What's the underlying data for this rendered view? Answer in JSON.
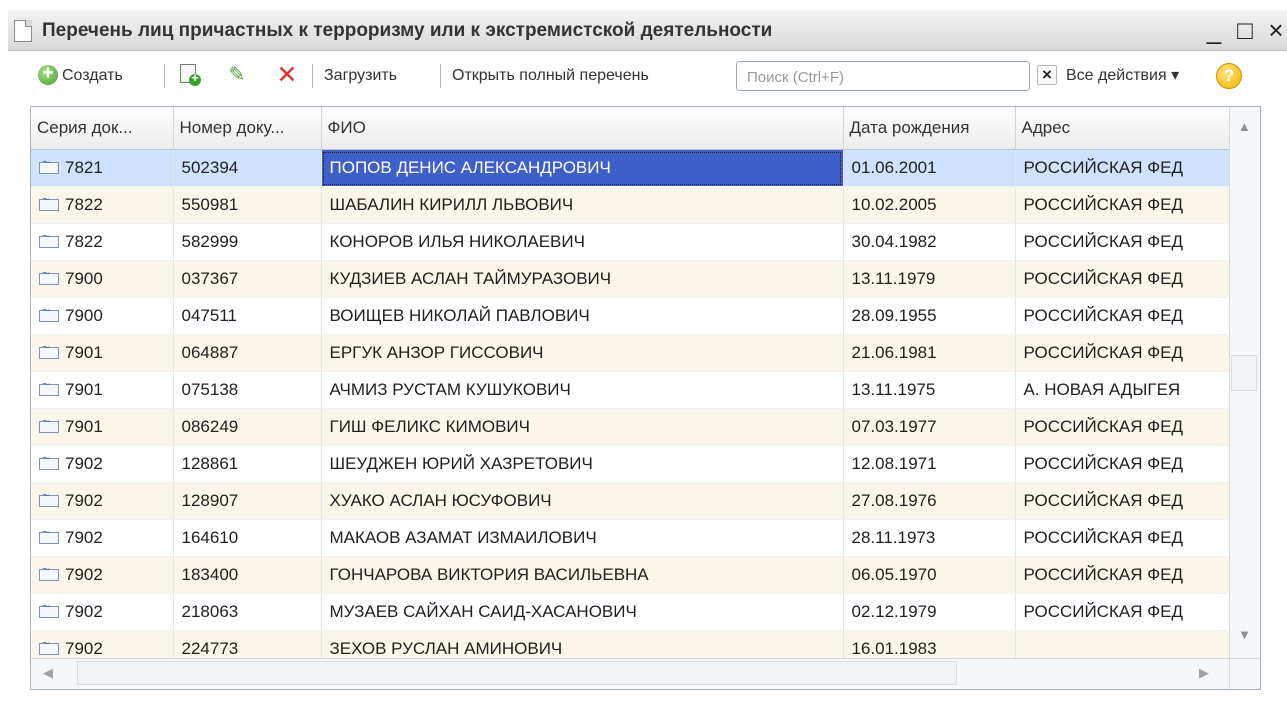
{
  "window": {
    "title": "Перечень лиц причастных к терроризму или к экстремистской деятельности",
    "minimize": "_",
    "maximize": "□",
    "close": "×"
  },
  "toolbar": {
    "create_label": "Создать",
    "load_label": "Загрузить",
    "open_full_label": "Открыть полный перечень",
    "search_placeholder": "Поиск (Ctrl+F)",
    "search_value": "",
    "clear_label": "×",
    "all_actions_label": "Все действия ▾",
    "help_label": "?"
  },
  "table": {
    "columns": [
      "Серия док...",
      "Номер доку...",
      "ФИО",
      "Дата рождения",
      "Адрес"
    ],
    "rows": [
      {
        "series": "7821",
        "number": "502394",
        "fio": "ПОПОВ ДЕНИС АЛЕКСАНДРОВИЧ",
        "birth": "01.06.2001",
        "address": "РОССИЙСКАЯ ФЕД"
      },
      {
        "series": "7822",
        "number": "550981",
        "fio": "ШАБАЛИН КИРИЛЛ ЛЬВОВИЧ",
        "birth": "10.02.2005",
        "address": "РОССИЙСКАЯ ФЕД"
      },
      {
        "series": "7822",
        "number": "582999",
        "fio": "КОНОРОВ ИЛЬЯ НИКОЛАЕВИЧ",
        "birth": "30.04.1982",
        "address": "РОССИЙСКАЯ ФЕД"
      },
      {
        "series": "7900",
        "number": "037367",
        "fio": "КУДЗИЕВ АСЛАН ТАЙМУРАЗОВИЧ",
        "birth": "13.11.1979",
        "address": "РОССИЙСКАЯ ФЕД"
      },
      {
        "series": "7900",
        "number": "047511",
        "fio": "ВОИЩЕВ НИКОЛАЙ ПАВЛОВИЧ",
        "birth": "28.09.1955",
        "address": "РОССИЙСКАЯ ФЕД"
      },
      {
        "series": "7901",
        "number": "064887",
        "fio": "ЕРГУК АНЗОР ГИССОВИЧ",
        "birth": "21.06.1981",
        "address": "РОССИЙСКАЯ ФЕД"
      },
      {
        "series": "7901",
        "number": "075138",
        "fio": "АЧМИЗ РУСТАМ КУШУКОВИЧ",
        "birth": "13.11.1975",
        "address": "А. НОВАЯ АДЫГЕЯ"
      },
      {
        "series": "7901",
        "number": "086249",
        "fio": "ГИШ ФЕЛИКС КИМОВИЧ",
        "birth": "07.03.1977",
        "address": "РОССИЙСКАЯ ФЕД"
      },
      {
        "series": "7902",
        "number": "128861",
        "fio": "ШЕУДЖЕН ЮРИЙ ХАЗРЕТОВИЧ",
        "birth": "12.08.1971",
        "address": "РОССИЙСКАЯ ФЕД"
      },
      {
        "series": "7902",
        "number": "128907",
        "fio": "ХУАКО АСЛАН ЮСУФОВИЧ",
        "birth": "27.08.1976",
        "address": "РОССИЙСКАЯ ФЕД"
      },
      {
        "series": "7902",
        "number": "164610",
        "fio": "МАКАОВ АЗАМАТ ИЗМАИЛОВИЧ",
        "birth": "28.11.1973",
        "address": "РОССИЙСКАЯ ФЕД"
      },
      {
        "series": "7902",
        "number": "183400",
        "fio": "ГОНЧАРОВА ВИКТОРИЯ ВАСИЛЬЕВНА",
        "birth": "06.05.1970",
        "address": "РОССИЙСКАЯ ФЕД"
      },
      {
        "series": "7902",
        "number": "218063",
        "fio": "МУЗАЕВ САЙХАН САИД-ХАСАНОВИЧ",
        "birth": "02.12.1979",
        "address": "РОССИЙСКАЯ ФЕД"
      },
      {
        "series": "7902",
        "number": "224773",
        "fio": "ЗЕХОВ РУСЛАН АМИНОВИЧ",
        "birth": "16.01.1983",
        "address": ""
      }
    ]
  }
}
